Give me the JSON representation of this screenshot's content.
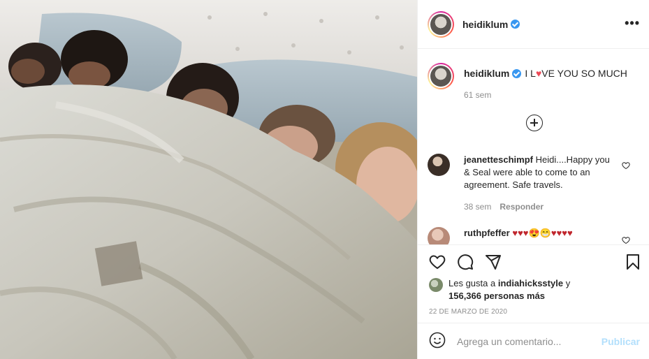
{
  "post": {
    "username": "heidiklum",
    "verified": true,
    "more_icon": "more-horizontal-icon",
    "photo_description_icon": "photo"
  },
  "caption": {
    "username": "heidiklum",
    "text_before_heart": "I L",
    "heart": "♥",
    "text_after_heart": "VE YOU SO MUCH",
    "time": "61 sem"
  },
  "comments": [
    {
      "username": "jeanetteschimpf",
      "text": "Heidi....Happy you & Seal were able to come to an agreement. Safe travels.",
      "time": "38 sem",
      "reply_label": "Responder"
    },
    {
      "username": "ruthpfeffer",
      "text": "♥♥♥😍😁♥♥♥♥"
    }
  ],
  "likes": {
    "prefix": "Les gusta a",
    "liker": "indiahicksstyle",
    "conjunction": "y",
    "count": "156,366 personas más"
  },
  "date": "22 DE MARZO DE 2020",
  "add_comment": {
    "placeholder": "Agrega un comentario...",
    "publish_label": "Publicar"
  },
  "colors": {
    "heart": "#ed4956",
    "verified": "#3897f0",
    "publish_disabled": "#b2dffc"
  }
}
